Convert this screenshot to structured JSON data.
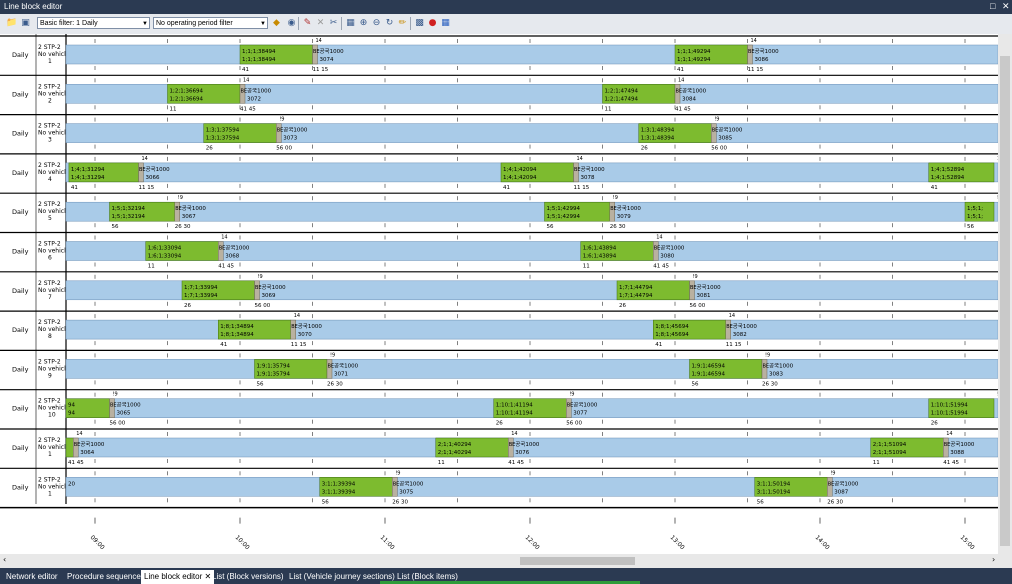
{
  "window": {
    "title": "Line block editor"
  },
  "toolbar": {
    "filter_value": "Basic filter: 1 Daily",
    "period_value": "No operating period filter"
  },
  "tabs": [
    {
      "label": "Network editor",
      "active": false
    },
    {
      "label": "Procedure sequence",
      "active": false
    },
    {
      "label": "Line block editor",
      "active": true
    },
    {
      "label": "List (Block versions)",
      "active": false
    },
    {
      "label": "List (Vehicle journey sections)",
      "active": false
    },
    {
      "label": "List (Block items)",
      "active": false
    }
  ],
  "colors": {
    "title_bar": "#2b3a52",
    "lane": "#a9cbe8",
    "block": "#7dbb2f",
    "pause": "#b9b1a0",
    "row_border": "#000000"
  },
  "timeline": {
    "ticks": [
      "09:00",
      "10:00",
      "11:00",
      "12:00",
      "13:00",
      "14:00",
      "15:00"
    ],
    "start_hour": 8.8
  },
  "rows": [
    {
      "daytype": "Daily",
      "line": "2 STP-2",
      "vehicle": "No vehicl",
      "num": "1",
      "marker": "14",
      "blocks": [
        {
          "start": 10.0,
          "end": 10.5,
          "l1": "1;1;1;38494",
          "l2": "1;1;1;38494",
          "p": "BE",
          "r1": "공국1000",
          "r2": "3074",
          "bl": "41",
          "br": "11 15"
        },
        {
          "start": 13.0,
          "end": 13.5,
          "l1": "1;1;1;49294",
          "l2": "1;1;1;49294",
          "p": "BE",
          "r1": "공국1000",
          "r2": "3086",
          "bl": "41",
          "br": "11 15"
        }
      ]
    },
    {
      "daytype": "Daily",
      "line": "2 STP-2",
      "vehicle": "No vehicl",
      "num": "2",
      "marker": "14",
      "blocks": [
        {
          "start": 9.5,
          "end": 10.0,
          "l1": "1;2;1;36694",
          "l2": "1;2;1;36694",
          "p": "BE",
          "r1": "공국1000",
          "r2": "3072",
          "bl": "11",
          "br": "41 45"
        },
        {
          "start": 12.5,
          "end": 13.0,
          "l1": "1;2;1;47494",
          "l2": "1;2;1;47494",
          "p": "BE",
          "r1": "공국1000",
          "r2": "3084",
          "bl": "11",
          "br": "41 45"
        }
      ]
    },
    {
      "daytype": "Daily",
      "line": "2 STP-2",
      "vehicle": "No vehicl",
      "num": "3",
      "marker": "!9",
      "blocks": [
        {
          "start": 9.75,
          "end": 10.25,
          "l1": "1;3;1;37594",
          "l2": "1;3;1;37594",
          "p": "BE",
          "r1": "공국1000",
          "r2": "3073",
          "bl": "26",
          "br": "56 00"
        },
        {
          "start": 12.75,
          "end": 13.25,
          "l1": "1;3;1;48394",
          "l2": "1;3;1;48394",
          "p": "BE",
          "r1": "공국1000",
          "r2": "3085",
          "bl": "26",
          "br": "56 00"
        }
      ]
    },
    {
      "daytype": "Daily",
      "line": "2 STP-2",
      "vehicle": "No vehicl",
      "num": "4",
      "marker": "14",
      "blocks": [
        {
          "start": 8.82,
          "end": 9.3,
          "l1": "1;4;1;31294",
          "l2": "1;4;1;31294",
          "p": "BE",
          "r1": "공국1000",
          "r2": "3066",
          "bl": "41",
          "br": "11 15"
        },
        {
          "start": 11.8,
          "end": 12.3,
          "l1": "1;4;1;42094",
          "l2": "1;4;1;42094",
          "p": "BE",
          "r1": "공국1000",
          "r2": "3078",
          "bl": "41",
          "br": "11 15"
        },
        {
          "start": 14.75,
          "end": 15.2,
          "l1": "1;4;1;52894",
          "l2": "1;4;1;52894",
          "p": "",
          "r1": "",
          "r2": "",
          "bl": "41",
          "br": ""
        }
      ]
    },
    {
      "daytype": "Daily",
      "line": "2 STP-2",
      "vehicle": "No vehicl",
      "num": "5",
      "marker": "!9",
      "blocks": [
        {
          "start": 9.1,
          "end": 9.55,
          "l1": "1;5;1;32194",
          "l2": "1;5;1;32194",
          "p": "BE",
          "r1": "공국1000",
          "r2": "3067",
          "bl": "56",
          "br": "26 30"
        },
        {
          "start": 12.1,
          "end": 12.55,
          "l1": "1;5;1;42994",
          "l2": "1;5;1;42994",
          "p": "BE",
          "r1": "공국1000",
          "r2": "3079",
          "bl": "56",
          "br": "26 30"
        },
        {
          "start": 15.0,
          "end": 15.2,
          "l1": "1;5;1;",
          "l2": "1;5;1;",
          "p": "",
          "r1": "",
          "r2": "",
          "bl": "56",
          "br": ""
        }
      ]
    },
    {
      "daytype": "Daily",
      "line": "2 STP-2",
      "vehicle": "No vehicl",
      "num": "6",
      "marker": "14",
      "blocks": [
        {
          "start": 9.35,
          "end": 9.85,
          "l1": "1;6;1;33094",
          "l2": "1;6;1;33094",
          "p": "BE",
          "r1": "공국1000",
          "r2": "3068",
          "bl": "11",
          "br": "41 45"
        },
        {
          "start": 12.35,
          "end": 12.85,
          "l1": "1;6;1;43894",
          "l2": "1;6;1;43894",
          "p": "BE",
          "r1": "공국1000",
          "r2": "3080",
          "bl": "11",
          "br": "41 45"
        }
      ]
    },
    {
      "daytype": "Daily",
      "line": "2 STP-2",
      "vehicle": "No vehicl",
      "num": "7",
      "marker": "!9",
      "blocks": [
        {
          "start": 9.6,
          "end": 10.1,
          "l1": "1;7;1;33994",
          "l2": "1;7;1;33994",
          "p": "BE",
          "r1": "공국1000",
          "r2": "3069",
          "bl": "26",
          "br": "56 00"
        },
        {
          "start": 12.6,
          "end": 13.1,
          "l1": "1;7;1;44794",
          "l2": "1;7;1;44794",
          "p": "BE",
          "r1": "공국1000",
          "r2": "3081",
          "bl": "26",
          "br": "56 00"
        }
      ]
    },
    {
      "daytype": "Daily",
      "line": "2 STP-2",
      "vehicle": "No vehicl",
      "num": "8",
      "marker": "14",
      "blocks": [
        {
          "start": 9.85,
          "end": 10.35,
          "l1": "1;8;1;34894",
          "l2": "1;8;1;34894",
          "p": "BE",
          "r1": "공국1000",
          "r2": "3070",
          "bl": "41",
          "br": "11 15"
        },
        {
          "start": 12.85,
          "end": 13.35,
          "l1": "1;8;1;45694",
          "l2": "1;8;1;45694",
          "p": "BE",
          "r1": "공국1000",
          "r2": "3082",
          "bl": "41",
          "br": "11 15"
        }
      ]
    },
    {
      "daytype": "Daily",
      "line": "2 STP-2",
      "vehicle": "No vehicl",
      "num": "9",
      "marker": "!9",
      "blocks": [
        {
          "start": 10.1,
          "end": 10.6,
          "l1": "1;9;1;35794",
          "l2": "1;9;1;35794",
          "p": "BE",
          "r1": "공국1000",
          "r2": "3071",
          "bl": "56",
          "br": "26 30"
        },
        {
          "start": 13.1,
          "end": 13.6,
          "l1": "1;9;1;46594",
          "l2": "1;9;1;46594",
          "p": "BE",
          "r1": "공국1000",
          "r2": "3083",
          "bl": "56",
          "br": "26 30"
        }
      ]
    },
    {
      "daytype": "Daily",
      "line": "2 STP-2",
      "vehicle": "No vehicl",
      "num": "10",
      "marker": "!9",
      "blocks": [
        {
          "start": 8.8,
          "end": 9.1,
          "l1": "94",
          "l2": "94",
          "p": "BE",
          "r1": "공국1000",
          "r2": "3065",
          "bl": "",
          "br": "56 00"
        },
        {
          "start": 11.75,
          "end": 12.25,
          "l1": "1;10;1;41194",
          "l2": "1;10;1;41194",
          "p": "BE",
          "r1": "공국1000",
          "r2": "3077",
          "bl": "26",
          "br": "56 00"
        },
        {
          "start": 14.75,
          "end": 15.2,
          "l1": "1;10;1;51994",
          "l2": "1;10;1;51994",
          "p": "BE",
          "r1": "공국1000",
          "r2": "3089",
          "bl": "26",
          "br": "56 00"
        }
      ]
    },
    {
      "daytype": "Daily",
      "line": "2 STP-2",
      "vehicle": "No vehicl",
      "num": "1",
      "marker": "14",
      "blocks": [
        {
          "start": 8.8,
          "end": 8.85,
          "l1": "",
          "l2": "",
          "p": "BE",
          "r1": "공국1000",
          "r2": "3064",
          "bl": "41 45",
          "br": ""
        },
        {
          "start": 11.35,
          "end": 11.85,
          "l1": "2;1;1;40294",
          "l2": "2;1;1;40294",
          "p": "BE",
          "r1": "공국1000",
          "r2": "3076",
          "bl": "11",
          "br": "41 45"
        },
        {
          "start": 14.35,
          "end": 14.85,
          "l1": "2;1;1;51094",
          "l2": "2;1;1;51094",
          "p": "BE",
          "r1": "공국1000",
          "r2": "3088",
          "bl": "11",
          "br": "41 45"
        }
      ]
    },
    {
      "daytype": "Daily",
      "line": "2 STP-2",
      "vehicle": "No vehicl",
      "num": "1",
      "marker": "!9",
      "blocks": [
        {
          "start": 8.8,
          "end": 8.8,
          "l1": "20",
          "l2": "",
          "p": "",
          "r1": "",
          "r2": "",
          "bl": "",
          "br": ""
        },
        {
          "start": 10.55,
          "end": 11.05,
          "l1": "3;1;1;39394",
          "l2": "3;1;1;39394",
          "p": "BE",
          "r1": "공국1000",
          "r2": "3075",
          "bl": "56",
          "br": "26 30"
        },
        {
          "start": 13.55,
          "end": 14.05,
          "l1": "3;1;1;50194",
          "l2": "3;1;1;50194",
          "p": "BE",
          "r1": "공국1000",
          "r2": "3087",
          "bl": "56",
          "br": "26 30"
        }
      ]
    }
  ]
}
